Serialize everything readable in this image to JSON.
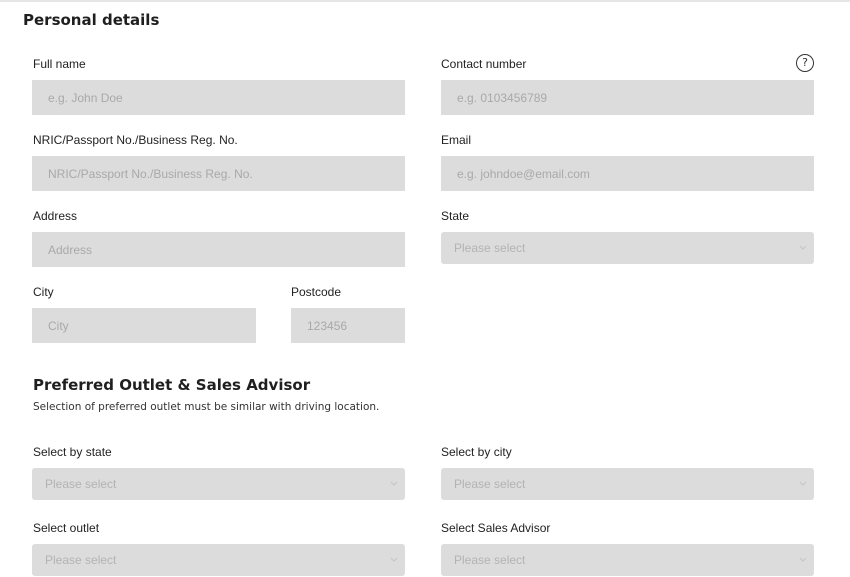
{
  "personal_details": {
    "title": "Personal details",
    "help_icon": "?",
    "full_name": {
      "label": "Full name",
      "placeholder": "e.g. John Doe"
    },
    "contact_number": {
      "label": "Contact number",
      "placeholder": "e.g. 0103456789"
    },
    "nric": {
      "label": "NRIC/Passport No./Business Reg. No.",
      "placeholder": "NRIC/Passport No./Business Reg. No."
    },
    "email": {
      "label": "Email",
      "placeholder": "e.g. johndoe@email.com"
    },
    "address": {
      "label": "Address",
      "placeholder": "Address"
    },
    "state": {
      "label": "State",
      "value": "Please select"
    },
    "city": {
      "label": "City",
      "placeholder": "City"
    },
    "postcode": {
      "label": "Postcode",
      "placeholder": "123456"
    }
  },
  "outlet": {
    "title": "Preferred Outlet & Sales Advisor",
    "note": "Selection of preferred outlet must be similar with driving location.",
    "select_state": {
      "label": "Select by state",
      "value": "Please select"
    },
    "select_city": {
      "label": "Select by city",
      "value": "Please select"
    },
    "select_outlet": {
      "label": "Select outlet",
      "value": "Please select"
    },
    "select_advisor": {
      "label": "Select Sales Advisor",
      "value": "Please select"
    }
  },
  "icons": {
    "help": "question-circle-icon",
    "dropdown": "chevron-down-icon"
  },
  "colors": {
    "field_bg": "#dcdcdc",
    "placeholder": "#a9a9a9",
    "text": "#1f1f1f"
  }
}
